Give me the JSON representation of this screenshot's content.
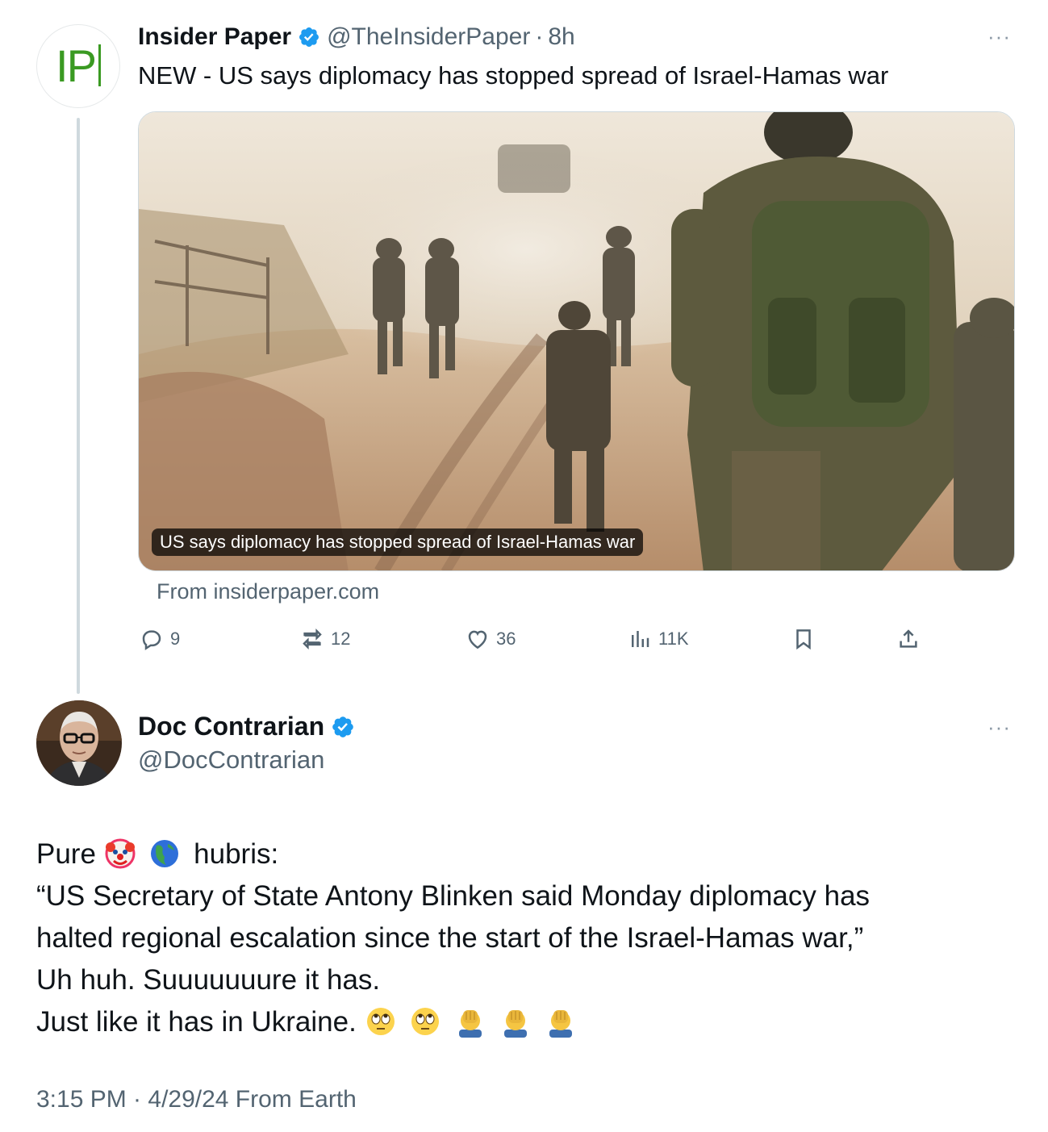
{
  "tweet1": {
    "avatar_text": "IP",
    "display_name": "Insider Paper",
    "handle": "@TheInsiderPaper",
    "separator": "·",
    "time_ago": "8h",
    "more": "···",
    "text": "NEW - US says diplomacy has stopped spread of Israel-Hamas war",
    "card_caption": "US says diplomacy has stopped spread of Israel-Hamas war",
    "card_source": "From insiderpaper.com",
    "stats": {
      "replies": "9",
      "reposts": "12",
      "likes": "36",
      "views": "11K"
    }
  },
  "tweet2": {
    "display_name": "Doc Contrarian",
    "handle": "@DocContrarian",
    "more": "···",
    "lines": {
      "l1_word1": "Pure",
      "l1_word2": "hubris:",
      "l2": "“US Secretary of State Antony Blinken said Monday diplomacy has",
      "l3": "halted regional escalation since the start of the Israel-Hamas war,”",
      "l4": "Uh huh. Suuuuuuure it has.",
      "l5": "Just like it has in Ukraine."
    },
    "emojis_line1": [
      "clown-face-emoji",
      "globe-americas-emoji"
    ],
    "emojis_line5": [
      "eye-roll-emoji",
      "eye-roll-emoji",
      "facepalm-emoji",
      "facepalm-emoji",
      "facepalm-emoji"
    ],
    "timestamp": "3:15 PM · 4/29/24 From Earth"
  },
  "colors": {
    "verified": "#1d9bf0",
    "secondary_text": "#536471",
    "ip_green": "#3a9a22"
  }
}
